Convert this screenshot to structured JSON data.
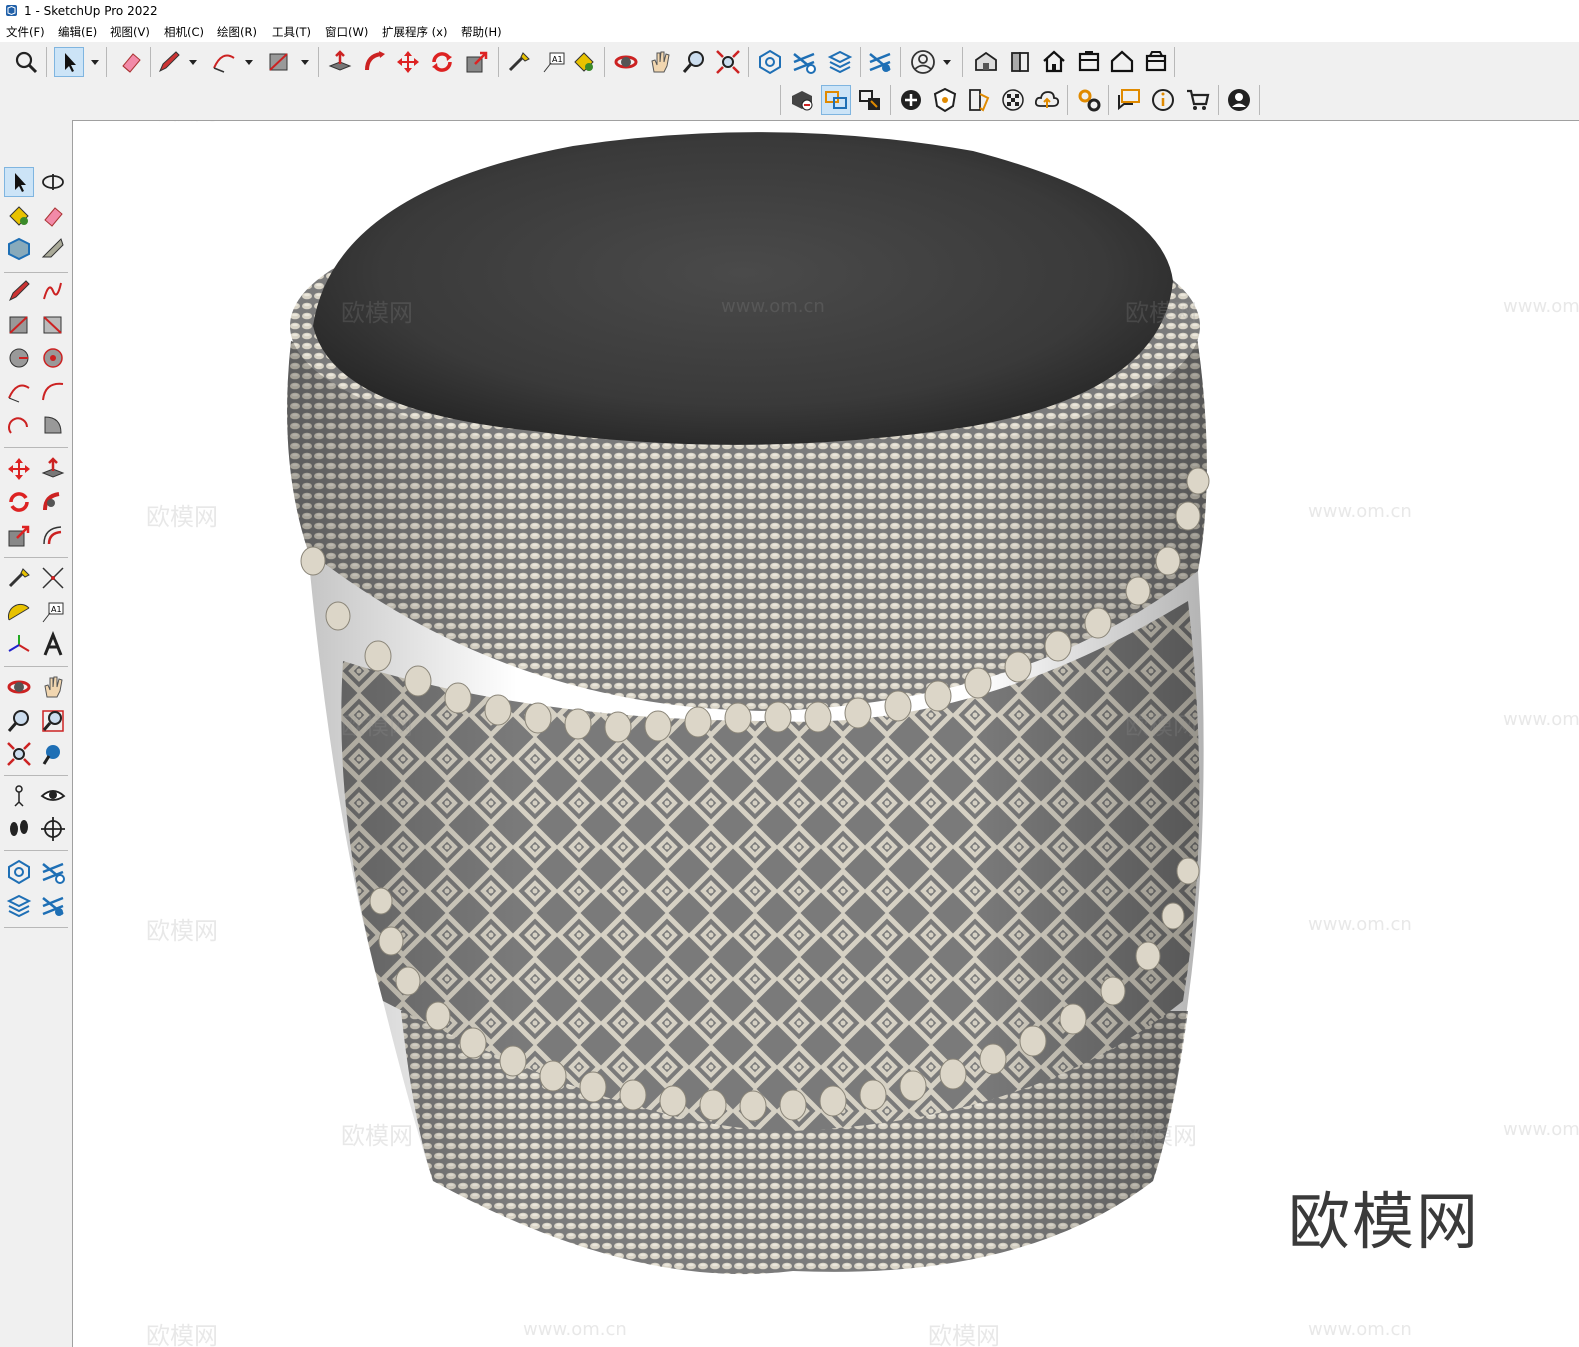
{
  "window": {
    "title": "1 - SketchUp Pro 2022",
    "app_icon": "sketchup-logo-icon"
  },
  "menu": [
    {
      "label": "文件(F)"
    },
    {
      "label": "编辑(E)"
    },
    {
      "label": "视图(V)"
    },
    {
      "label": "相机(C)"
    },
    {
      "label": "绘图(R)"
    },
    {
      "label": "工具(T)"
    },
    {
      "label": "窗口(W)"
    },
    {
      "label": "扩展程序 (x)"
    },
    {
      "label": "帮助(H)"
    }
  ],
  "toolbar_top": [
    "search-icon",
    "select-arrow-icon",
    "eraser-icon",
    "pencil-icon",
    "arc-icon",
    "rectangle-icon",
    "push-pull-icon",
    "follow-me-icon",
    "move-icon",
    "rotate-icon",
    "scale-icon",
    "tape-measure-icon",
    "text-icon",
    "paint-bucket-icon",
    "orbit-icon",
    "pan-icon",
    "zoom-icon",
    "zoom-extents-icon",
    "warehouse-icon",
    "extension-icon",
    "layers-icon",
    "settings-icon",
    "user-icon",
    "iso-view-icon",
    "right-view-icon",
    "front-view-icon",
    "top-view-icon",
    "home-view-icon",
    "back-view-icon"
  ],
  "toolbar_second": [
    "solid-tools-icon",
    "section-plane-icon",
    "scenes-icon",
    "add-location-icon",
    "shield-icon",
    "styles-icon",
    "checker-icon",
    "cloud-icon",
    "gears-icon",
    "message-icon",
    "info-icon",
    "cart-icon",
    "account-icon"
  ],
  "watermarks": {
    "brand": "欧模网",
    "url": "www.om.cn"
  },
  "corner_brand": "欧模网",
  "colors": {
    "cushion": "#3a3a3a",
    "rope_light": "#d8d3c6",
    "rope_dark": "#7a7a7a",
    "active_tool": "#cce4f7"
  }
}
